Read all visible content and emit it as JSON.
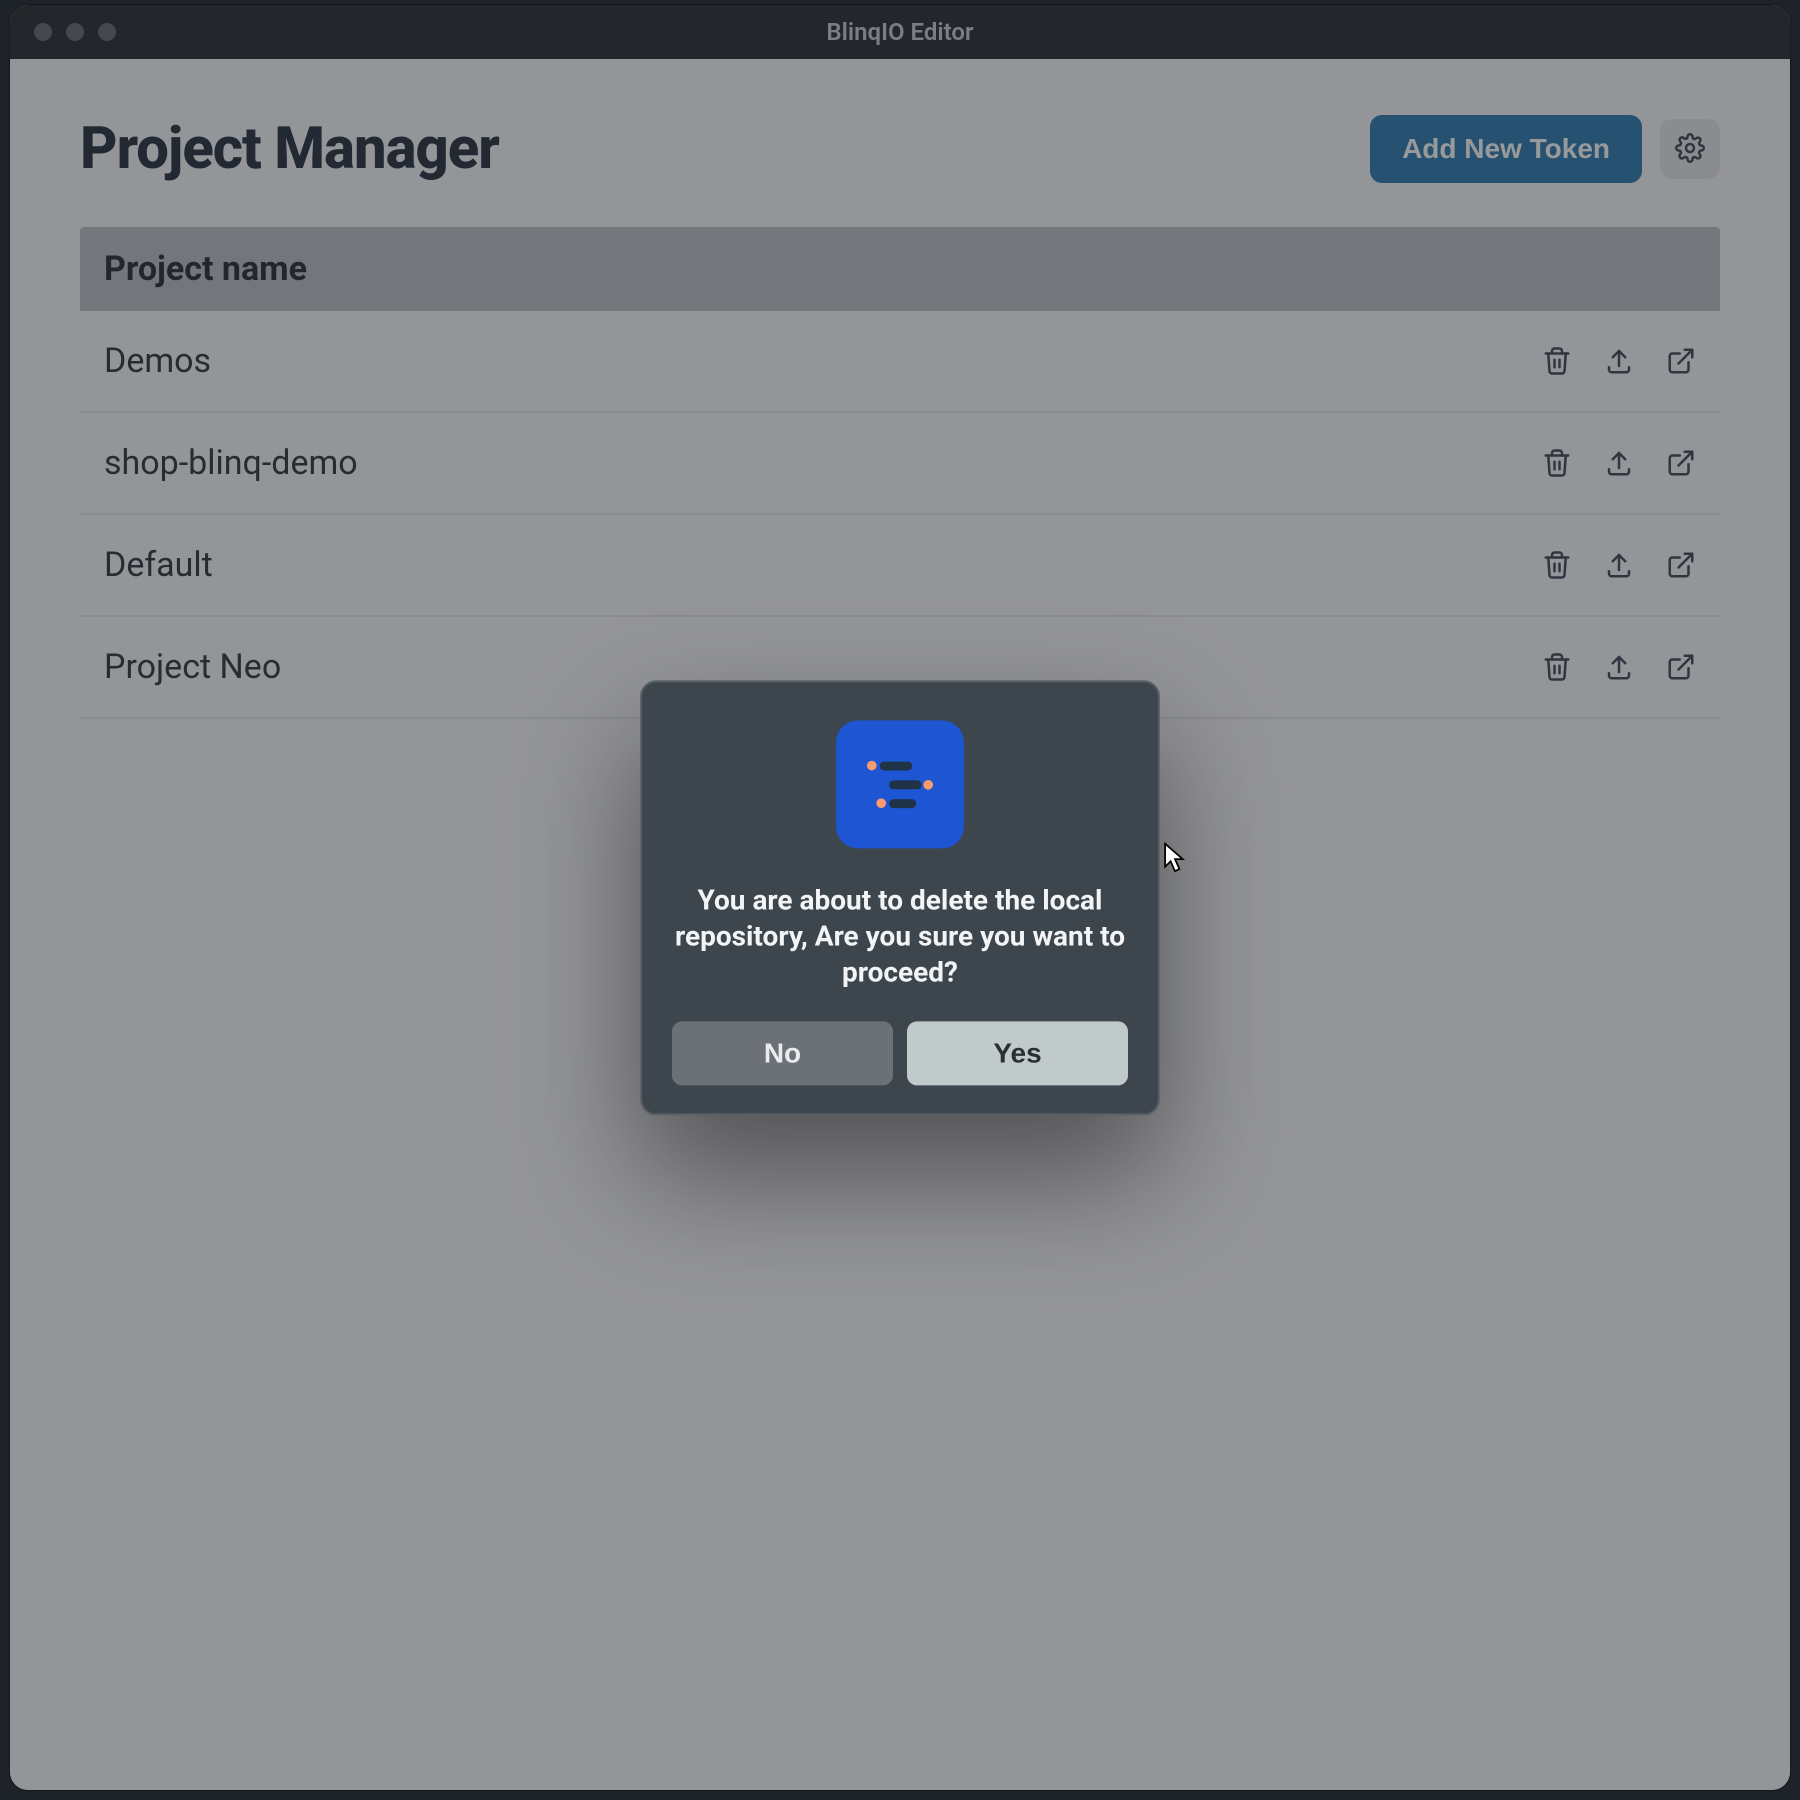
{
  "window": {
    "title": "BlinqIO Editor"
  },
  "page": {
    "title": "Project Manager",
    "add_token_label": "Add New Token"
  },
  "columns": {
    "project_name": "Project name"
  },
  "projects": [
    {
      "name": "Demos"
    },
    {
      "name": "shop-blinq-demo"
    },
    {
      "name": "Default"
    },
    {
      "name": "Project Neo"
    }
  ],
  "icons": {
    "gear": "gear-icon",
    "trash": "trash-icon",
    "upload": "upload-icon",
    "open_external": "external-link-icon",
    "app_logo": "blinqio-logo"
  },
  "dialog": {
    "message": "You are about to delete the local repository, Are you sure you want to proceed?",
    "no_label": "No",
    "yes_label": "Yes"
  },
  "colors": {
    "primary_button": "#2776ad",
    "dialog_bg": "#3d464c",
    "logo_bg": "#1d55d2"
  }
}
